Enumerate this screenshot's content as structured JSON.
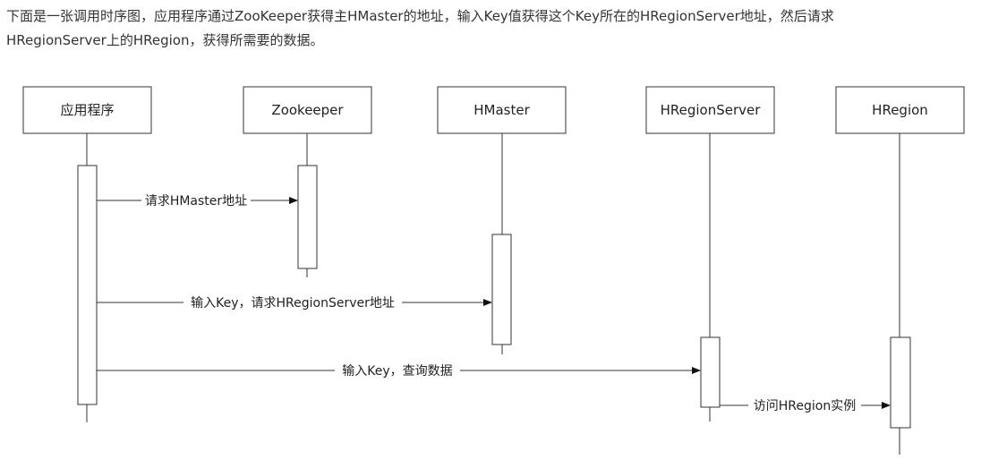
{
  "intro": {
    "line1": "下面是一张调用时序图，应用程序通过ZooKeeper获得主HMaster的地址，输入Key值获得这个Key所在的HRegionServer地址，然后请求",
    "line2": "HRegionServer上的HRegion，获得所需要的数据。"
  },
  "diagram": {
    "participants": [
      {
        "id": "app",
        "label": "应用程序"
      },
      {
        "id": "zk",
        "label": "Zookeeper"
      },
      {
        "id": "hmaster",
        "label": "HMaster"
      },
      {
        "id": "hrs",
        "label": "HRegionServer"
      },
      {
        "id": "hregion",
        "label": "HRegion"
      }
    ],
    "messages": [
      {
        "from": "app",
        "to": "zk",
        "label": "请求HMaster地址"
      },
      {
        "from": "app",
        "to": "hmaster",
        "label": "输入Key，请求HRegionServer地址"
      },
      {
        "from": "app",
        "to": "hrs",
        "label": "输入Key，查询数据"
      },
      {
        "from": "hrs",
        "to": "hregion",
        "label": "访问HRegion实例"
      }
    ]
  }
}
